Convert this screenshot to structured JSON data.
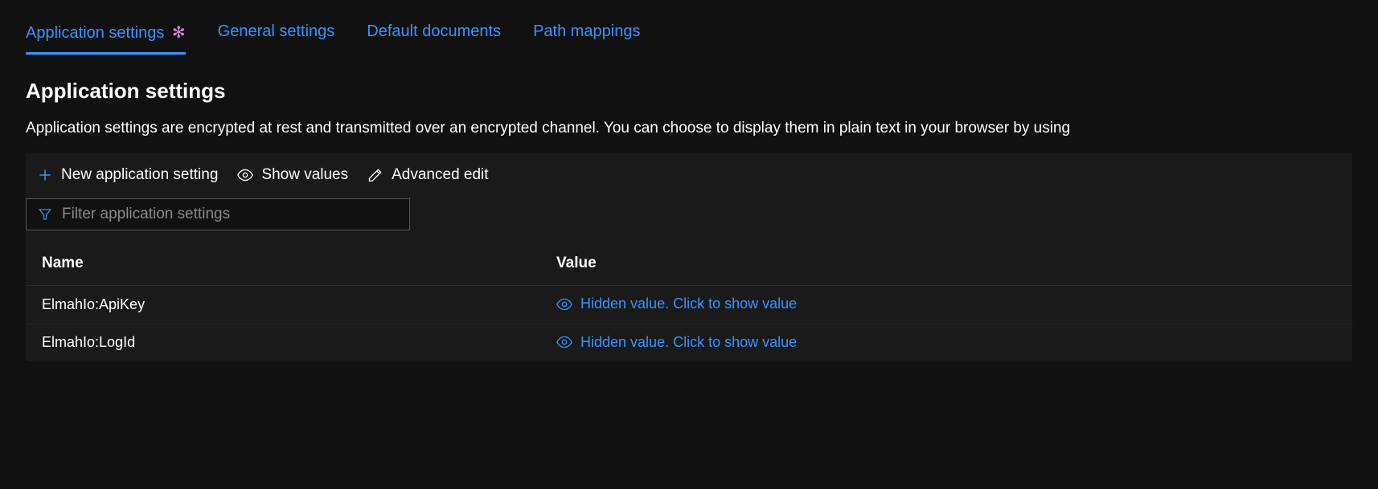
{
  "tabs": {
    "application_settings": "Application settings",
    "general_settings": "General settings",
    "default_documents": "Default documents",
    "path_mappings": "Path mappings",
    "dirty_indicator": "✻"
  },
  "section": {
    "title": "Application settings",
    "description": "Application settings are encrypted at rest and transmitted over an encrypted channel. You can choose to display them in plain text in your browser by using"
  },
  "toolbar": {
    "new_application_setting": "New application setting",
    "show_values": "Show values",
    "advanced_edit": "Advanced edit"
  },
  "filter": {
    "placeholder": "Filter application settings"
  },
  "table": {
    "headers": {
      "name": "Name",
      "value": "Value"
    },
    "rows": [
      {
        "name": "ElmahIo:ApiKey",
        "value_label": "Hidden value. Click to show value"
      },
      {
        "name": "ElmahIo:LogId",
        "value_label": "Hidden value. Click to show value"
      }
    ]
  }
}
